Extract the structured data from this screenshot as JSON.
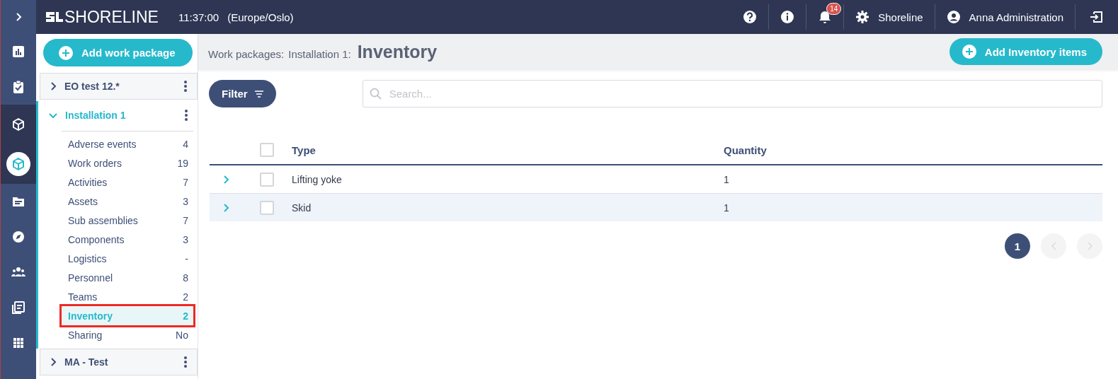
{
  "rail": {
    "toggle": {
      "expanded": false
    },
    "items": [
      {
        "selected": false,
        "highlighted": false
      },
      {
        "selected": false,
        "highlighted": false
      },
      {
        "selected": false,
        "highlighted": true
      },
      {
        "selected": true,
        "highlighted": true
      },
      {
        "selected": false,
        "highlighted": false
      },
      {
        "selected": false,
        "highlighted": false
      },
      {
        "selected": false,
        "highlighted": false
      },
      {
        "selected": false,
        "highlighted": false
      },
      {
        "selected": false,
        "highlighted": false
      }
    ]
  },
  "top_bar": {
    "logo": "SHORELINE",
    "time": "11:37:00",
    "timezone": "(Europe/Oslo)",
    "notifications": "14",
    "company": "Shoreline",
    "user": "Anna Administration"
  },
  "sidebar": {
    "add_button": "Add work package",
    "groups": [
      {
        "label": "EO test 12.*",
        "expanded": false
      },
      {
        "label": "Installation 1",
        "expanded": true,
        "items": [
          {
            "label": "Adverse events",
            "count": "4",
            "selected": false,
            "annotated": false
          },
          {
            "label": "Work orders",
            "count": "19",
            "selected": false,
            "annotated": false
          },
          {
            "label": "Activities",
            "count": "7",
            "selected": false,
            "annotated": false
          },
          {
            "label": "Assets",
            "count": "3",
            "selected": false,
            "annotated": false
          },
          {
            "label": "Sub assemblies",
            "count": "7",
            "selected": false,
            "annotated": false
          },
          {
            "label": "Components",
            "count": "3",
            "selected": false,
            "annotated": false
          },
          {
            "label": "Logistics",
            "count": "-",
            "selected": false,
            "annotated": false
          },
          {
            "label": "Personnel",
            "count": "8",
            "selected": false,
            "annotated": false
          },
          {
            "label": "Teams",
            "count": "2",
            "selected": false,
            "annotated": false
          },
          {
            "label": "Inventory",
            "count": "2",
            "selected": true,
            "annotated": true
          },
          {
            "label": "Sharing",
            "count": "No",
            "selected": false,
            "annotated": false
          }
        ]
      },
      {
        "label": "MA - Test",
        "expanded": false
      }
    ]
  },
  "header": {
    "breadcrumb": [
      "Work packages:",
      "Installation 1:"
    ],
    "title": "Inventory",
    "add_button": "Add Inventory items"
  },
  "toolbar": {
    "filter_button": "Filter",
    "search": {
      "placeholder": "Search..."
    }
  },
  "table": {
    "all_checked": false,
    "columns": [
      "Type",
      "Quantity"
    ],
    "rows": [
      {
        "type": "Lifting yoke",
        "quantity": "1",
        "checked": false,
        "expanded": false
      },
      {
        "type": "Skid",
        "quantity": "1",
        "checked": false,
        "expanded": false
      }
    ]
  },
  "pagination": {
    "pages": [
      {
        "label": "1",
        "selected": true
      }
    ],
    "prev_disabled": true,
    "next_disabled": true
  }
}
